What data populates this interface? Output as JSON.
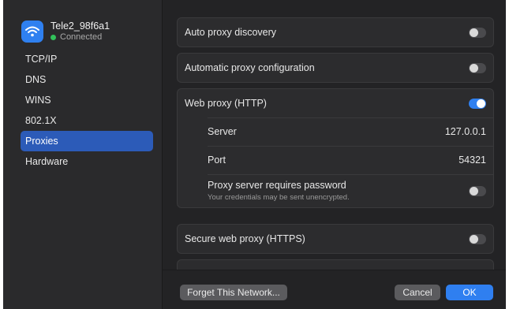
{
  "network": {
    "name": "Tele2_98f6a1",
    "status": "Connected"
  },
  "sidebar": {
    "items": [
      {
        "label": "TCP/IP"
      },
      {
        "label": "DNS"
      },
      {
        "label": "WINS"
      },
      {
        "label": "802.1X"
      },
      {
        "label": "Proxies",
        "selected": true
      },
      {
        "label": "Hardware"
      }
    ]
  },
  "proxies": {
    "auto_discovery": {
      "label": "Auto proxy discovery",
      "enabled": false
    },
    "auto_config": {
      "label": "Automatic proxy configuration",
      "enabled": false
    },
    "web_http": {
      "label": "Web proxy (HTTP)",
      "enabled": true,
      "server_label": "Server",
      "server_value": "127.0.0.1",
      "port_label": "Port",
      "port_value": "54321",
      "password_label": "Proxy server requires password",
      "password_hint": "Your credentials may be sent unencrypted.",
      "password_enabled": false
    },
    "secure_https": {
      "label": "Secure web proxy (HTTPS)",
      "enabled": false
    }
  },
  "footer": {
    "forget_label": "Forget This Network...",
    "cancel_label": "Cancel",
    "ok_label": "OK"
  },
  "colors": {
    "accent": "#2f80f0",
    "selected": "#2c5bb8",
    "connected": "#32c15a"
  }
}
